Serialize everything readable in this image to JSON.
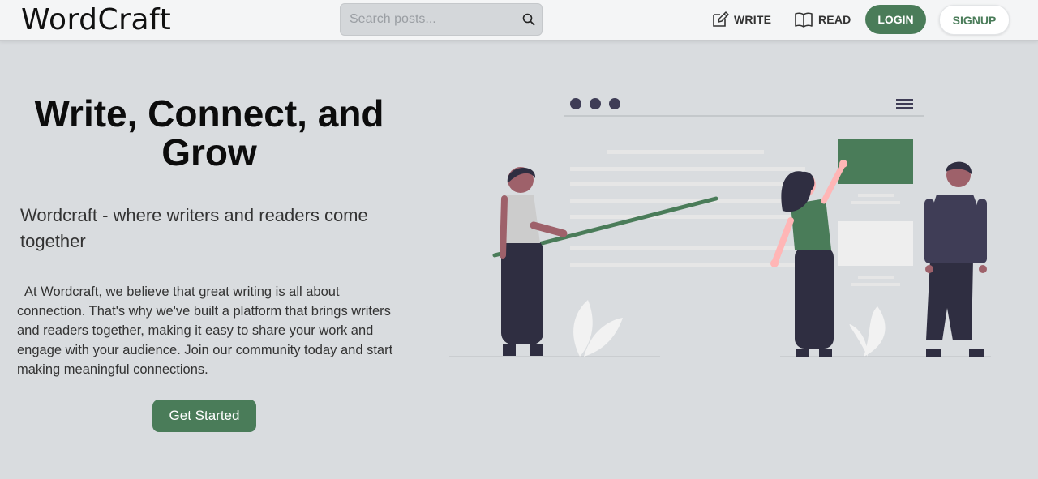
{
  "app": {
    "logo_text": "WordCraft"
  },
  "nav": {
    "search_placeholder": "Search posts...",
    "search_icon": "search-icon",
    "write_label": "WRITE",
    "write_icon": "pencil-square-icon",
    "read_label": "READ",
    "read_icon": "open-book-icon",
    "login_label": "LOGIN",
    "signup_label": "SIGNUP"
  },
  "hero": {
    "title": "Write, Connect, and Grow",
    "subtitle": "Wordcraft - where writers and readers come together",
    "description": "At Wordcraft, we believe that great writing is all about connection. That's why we've built a platform that brings writers and readers together, making it easy to share your work and engage with your audience. Join our community today and start making meaningful connections.",
    "cta_label": "Get Started"
  },
  "colors": {
    "accent": "#4a7c59",
    "background": "#d9dcdf",
    "navbar": "#f4f5f6",
    "illustration_dark": "#3f3d56",
    "illustration_skin": "#ffb6b6"
  }
}
